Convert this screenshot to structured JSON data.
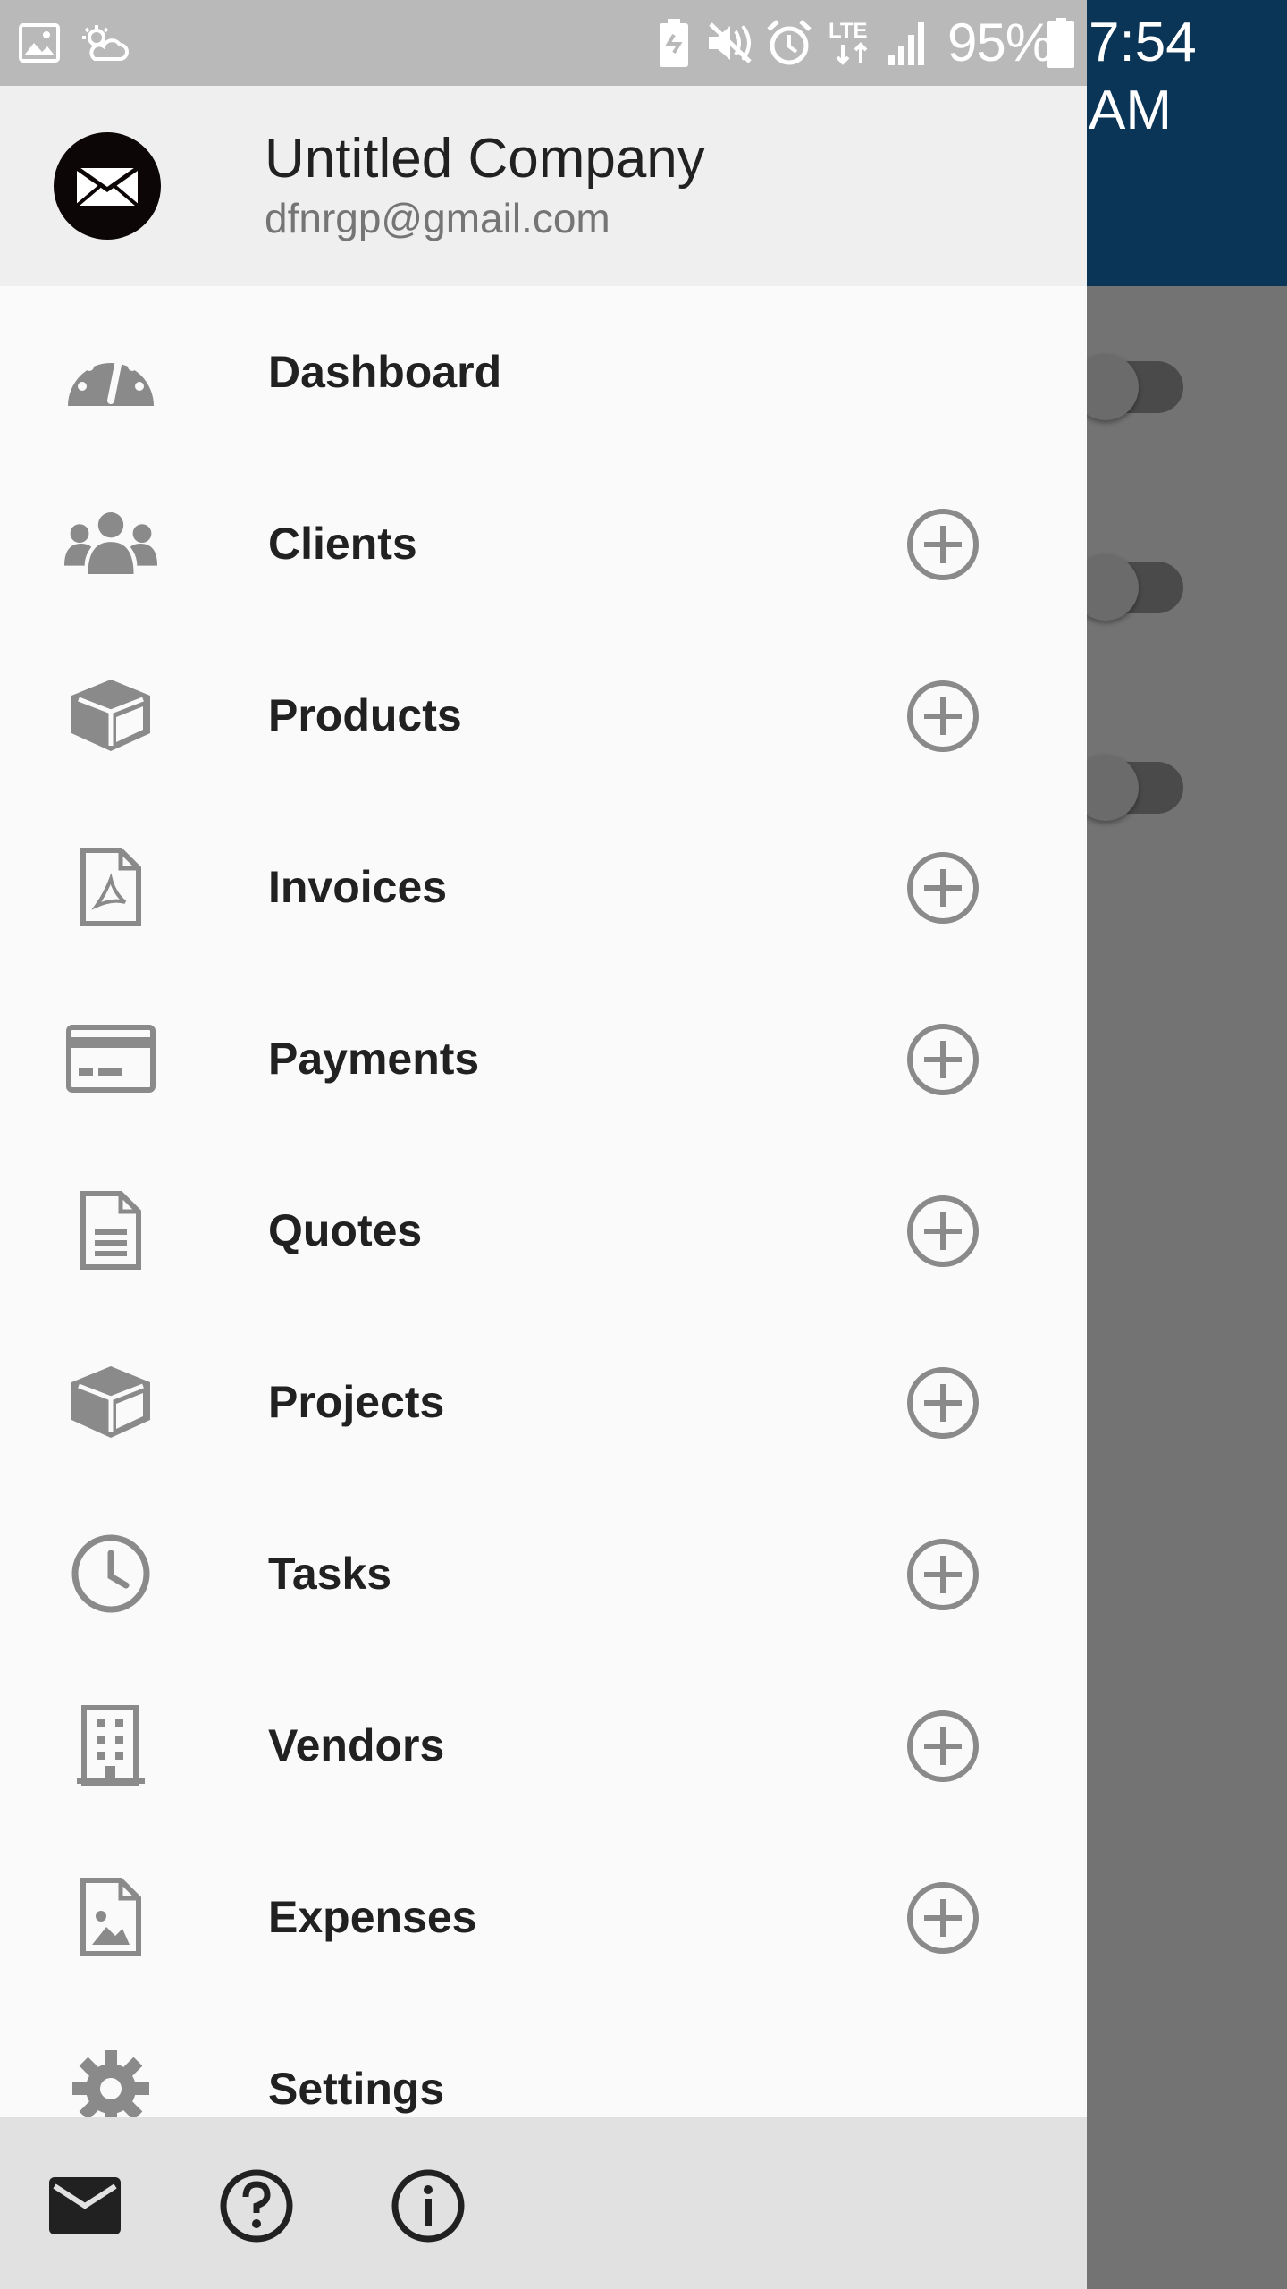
{
  "status_bar": {
    "battery_percent": "95%",
    "network": "LTE",
    "time": "7:54 AM",
    "icons": [
      "gallery-icon",
      "weather-icon",
      "battery-saver-icon",
      "mute-icon",
      "alarm-icon",
      "lte-icon",
      "signal-icon",
      "battery-icon"
    ]
  },
  "drawer": {
    "header": {
      "company_name": "Untitled Company",
      "email": "dfnrgp@gmail.com"
    },
    "items": [
      {
        "label": "Dashboard",
        "icon": "dashboard-gauge-icon",
        "has_add": false
      },
      {
        "label": "Clients",
        "icon": "users-icon",
        "has_add": true
      },
      {
        "label": "Products",
        "icon": "cube-icon",
        "has_add": true
      },
      {
        "label": "Invoices",
        "icon": "pdf-file-icon",
        "has_add": true
      },
      {
        "label": "Payments",
        "icon": "credit-card-icon",
        "has_add": true
      },
      {
        "label": "Quotes",
        "icon": "document-icon",
        "has_add": true
      },
      {
        "label": "Projects",
        "icon": "cube-icon",
        "has_add": true
      },
      {
        "label": "Tasks",
        "icon": "clock-icon",
        "has_add": true
      },
      {
        "label": "Vendors",
        "icon": "building-icon",
        "has_add": true
      },
      {
        "label": "Expenses",
        "icon": "image-file-icon",
        "has_add": true
      },
      {
        "label": "Settings",
        "icon": "gear-icon",
        "has_add": false
      }
    ],
    "footer": [
      "mail-icon",
      "help-icon",
      "info-icon"
    ]
  },
  "colors": {
    "app_bar": "#0a3557",
    "drawer_bg": "#fafafa",
    "header_bg": "#efefef",
    "footer_bg": "#e1e1e1",
    "icon_gray": "#8a8a8a",
    "scrim": "#737373"
  }
}
